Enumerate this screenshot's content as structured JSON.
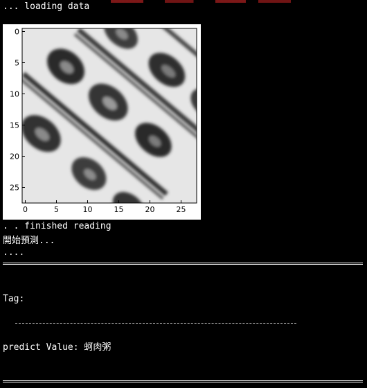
{
  "console": {
    "loading": "... loading data",
    "finished": ". . finished reading",
    "predict_start": "開始預測...",
    "dots": "....",
    "tag_label": "Tag:",
    "predict_label": "predict Value: 蚵肉粥"
  },
  "image_plot": {
    "x_ticks": [
      "0",
      "5",
      "10",
      "15",
      "20",
      "25"
    ],
    "y_ticks": [
      "0",
      "5",
      "10",
      "15",
      "20",
      "25"
    ],
    "colormap": "grayscale"
  },
  "colors": {
    "background": "#000000",
    "text": "#ffffff"
  }
}
